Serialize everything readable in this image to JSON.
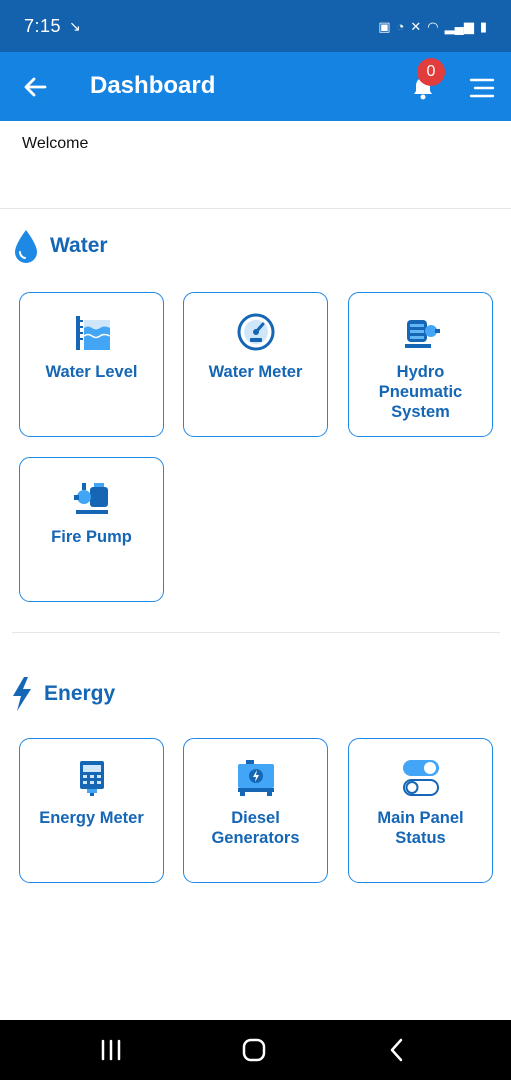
{
  "status_bar": {
    "time": "7:15"
  },
  "app_bar": {
    "title": "Dashboard",
    "notification_count": "0"
  },
  "welcome_text": "Welcome",
  "sections": [
    {
      "title": "Water",
      "icon": "water-drop-icon",
      "cards": [
        {
          "label": "Water Level",
          "icon": "water-level-icon"
        },
        {
          "label": "Water Meter",
          "icon": "gauge-icon"
        },
        {
          "label": "Hydro Pneumatic System",
          "icon": "motor-pump-icon"
        },
        {
          "label": "Fire Pump",
          "icon": "fire-pump-icon"
        }
      ]
    },
    {
      "title": "Energy",
      "icon": "lightning-icon",
      "cards": [
        {
          "label": "Energy Meter",
          "icon": "energy-meter-icon"
        },
        {
          "label": "Diesel Generators",
          "icon": "generator-icon"
        },
        {
          "label": "Main Panel Status",
          "icon": "toggle-switch-icon"
        }
      ]
    }
  ],
  "colors": {
    "status_bar": "#1462ad",
    "app_bar": "#1483e2",
    "accent": "#1566b5",
    "card_border": "#1e88e5",
    "badge": "#e23d3d"
  }
}
